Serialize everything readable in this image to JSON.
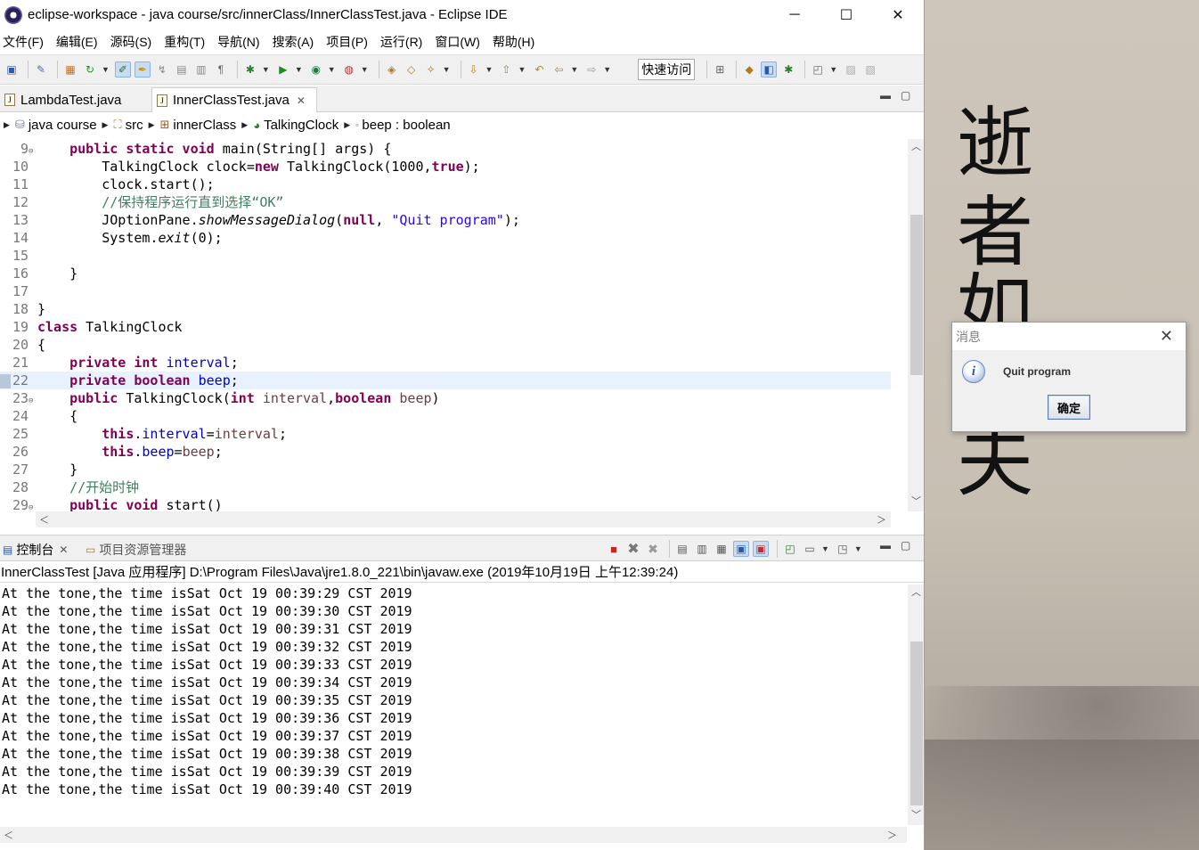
{
  "window": {
    "title": "eclipse-workspace - java course/src/innerClass/InnerClassTest.java - Eclipse IDE"
  },
  "menu": [
    "文件(F)",
    "编辑(E)",
    "源码(S)",
    "重构(T)",
    "导航(N)",
    "搜索(A)",
    "项目(P)",
    "运行(R)",
    "窗口(W)",
    "帮助(H)"
  ],
  "toolbar": {
    "quick_access": "快速访问"
  },
  "editor_tabs": [
    {
      "label": "LambdaTest.java",
      "active": false
    },
    {
      "label": "InnerClassTest.java",
      "active": true
    }
  ],
  "breadcrumb": [
    "java course",
    "src",
    "innerClass",
    "TalkingClock",
    "beep : boolean"
  ],
  "code_lines": [
    {
      "n": "9",
      "fold": "⊖",
      "html": "    <span class='kw'>public static void</span> main(String[] args) {"
    },
    {
      "n": "10",
      "fold": "",
      "html": "        TalkingClock <span class='fld' style='color:#000'>clock</span>=<span class='kw'>new</span> TalkingClock(1000,<span class='kw'>true</span>);"
    },
    {
      "n": "11",
      "fold": "",
      "html": "        clock.start();"
    },
    {
      "n": "12",
      "fold": "",
      "html": "        <span class='cmt'>//保持程序运行直到选择“OK”</span>"
    },
    {
      "n": "13",
      "fold": "",
      "html": "        JOptionPane.<span class='it'>showMessageDialog</span>(<span class='kw'>null</span>, <span class='str'>\"Quit program\"</span>);"
    },
    {
      "n": "14",
      "fold": "",
      "html": "        System.<span class='it'>exit</span>(0);"
    },
    {
      "n": "15",
      "fold": "",
      "html": ""
    },
    {
      "n": "16",
      "fold": "",
      "html": "    }"
    },
    {
      "n": "17",
      "fold": "",
      "html": ""
    },
    {
      "n": "18",
      "fold": "",
      "html": "}"
    },
    {
      "n": "19",
      "fold": "",
      "html": "<span class='kw'>class</span> TalkingClock"
    },
    {
      "n": "20",
      "fold": "",
      "html": "{"
    },
    {
      "n": "21",
      "fold": "",
      "html": "    <span class='kw'>private int</span> <span class='fld'>interval</span>;"
    },
    {
      "n": "22",
      "fold": "",
      "html": "    <span class='kw'>private boolean</span> <span class='fld'>beep</span>;"
    },
    {
      "n": "23",
      "fold": "⊖",
      "html": "    <span class='kw'>public</span> TalkingClock(<span class='kw'>int</span> <span style='color:#6a3e3e'>interval</span>,<span class='kw'>boolean</span> <span style='color:#6a3e3e'>beep</span>)"
    },
    {
      "n": "24",
      "fold": "",
      "html": "    {"
    },
    {
      "n": "25",
      "fold": "",
      "html": "        <span class='kw'>this</span>.<span class='fld'>interval</span>=<span style='color:#6a3e3e'>interval</span>;"
    },
    {
      "n": "26",
      "fold": "",
      "html": "        <span class='kw'>this</span>.<span class='fld'>beep</span>=<span style='color:#6a3e3e'>beep</span>;"
    },
    {
      "n": "27",
      "fold": "",
      "html": "    }"
    },
    {
      "n": "28",
      "fold": "",
      "html": "    <span class='cmt'>//开始时钟</span>"
    },
    {
      "n": "29",
      "fold": "⊖",
      "html": "    <span class='kw'>public void</span> start()"
    }
  ],
  "current_line": "22",
  "console": {
    "tabs": [
      "控制台",
      "项目资源管理器"
    ],
    "header": "InnerClassTest [Java 应用程序] D:\\Program Files\\Java\\jre1.8.0_221\\bin\\javaw.exe  (2019年10月19日 上午12:39:24)",
    "lines": [
      "At the tone,the time isSat Oct 19 00:39:29 CST 2019",
      "At the tone,the time isSat Oct 19 00:39:30 CST 2019",
      "At the tone,the time isSat Oct 19 00:39:31 CST 2019",
      "At the tone,the time isSat Oct 19 00:39:32 CST 2019",
      "At the tone,the time isSat Oct 19 00:39:33 CST 2019",
      "At the tone,the time isSat Oct 19 00:39:34 CST 2019",
      "At the tone,the time isSat Oct 19 00:39:35 CST 2019",
      "At the tone,the time isSat Oct 19 00:39:36 CST 2019",
      "At the tone,the time isSat Oct 19 00:39:37 CST 2019",
      "At the tone,the time isSat Oct 19 00:39:38 CST 2019",
      "At the tone,the time isSat Oct 19 00:39:39 CST 2019",
      "At the tone,the time isSat Oct 19 00:39:40 CST 2019"
    ]
  },
  "dialog": {
    "title": "消息",
    "message": "Quit program",
    "ok_label": "确定"
  },
  "desktop": {
    "calligraphy": [
      "逝",
      "者",
      "如",
      "夫"
    ]
  }
}
